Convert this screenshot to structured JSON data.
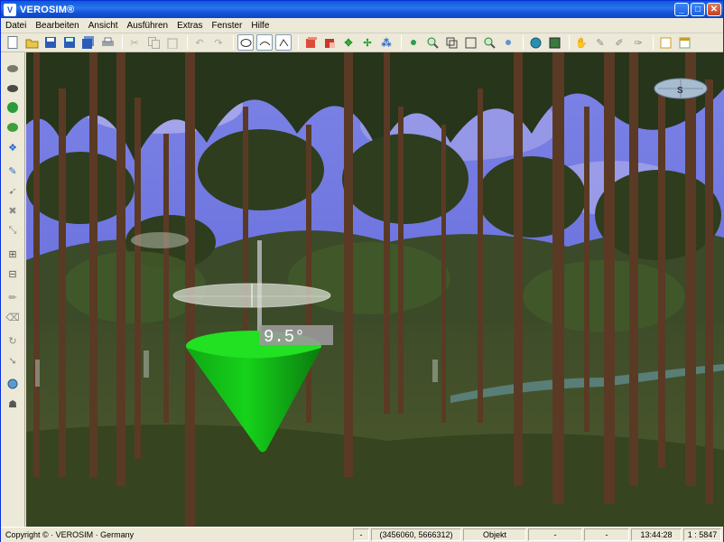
{
  "window": {
    "title": "VEROSIM®",
    "app_icon_label": "V"
  },
  "titlebar": {
    "minimize": "_",
    "maximize": "□",
    "close": "✕"
  },
  "menu": [
    "Datei",
    "Bearbeiten",
    "Ansicht",
    "Ausführen",
    "Extras",
    "Fenster",
    "Hilfe"
  ],
  "toolbar": {
    "icons": [
      "new-document-icon",
      "open-folder-icon",
      "save-icon",
      "save-as-icon",
      "save-all-icon",
      "print-icon",
      "cut-icon",
      "copy-icon",
      "paste-icon",
      "undo-icon",
      "redo-icon",
      "view-mode-1-icon",
      "view-mode-2-icon",
      "view-mode-3-icon",
      "red-cube-icon",
      "red-cube-2-icon",
      "move-icon",
      "rotate-move-icon",
      "transform-icon",
      "dot-icon",
      "zoom-in-icon",
      "zoom-frame-icon",
      "zoom-window-icon",
      "zoom-out-icon",
      "zoom-reset-icon",
      "globe-icon",
      "map-icon",
      "tool-a-icon",
      "tool-b-icon",
      "tool-c-icon",
      "tool-d-icon",
      "window-icon",
      "window-2-icon"
    ]
  },
  "leftbar": {
    "icons": [
      "terrain-icon",
      "brush-icon",
      "tree-icon",
      "forest-icon",
      "network-icon",
      "pen-icon",
      "measure-icon",
      "delete-icon",
      "transform-icon",
      "tile-h-icon",
      "tile-v-icon",
      "pencil-icon",
      "eraser-icon",
      "rotate-icon",
      "arrow-icon",
      "globe-icon",
      "robot-icon"
    ]
  },
  "scene": {
    "angle_label": "9.5°"
  },
  "colors": {
    "cone": "#14c214",
    "sky": "#6a6ee0"
  },
  "statusbar": {
    "copyright": "Copyright © · VEROSIM · Germany",
    "dash1": "-",
    "coordinates": "(3456060, 5666312)",
    "mode": "Objekt",
    "dash2": "-",
    "dash3": "-",
    "time": "13:44:28",
    "scale": "1 : 5847"
  }
}
